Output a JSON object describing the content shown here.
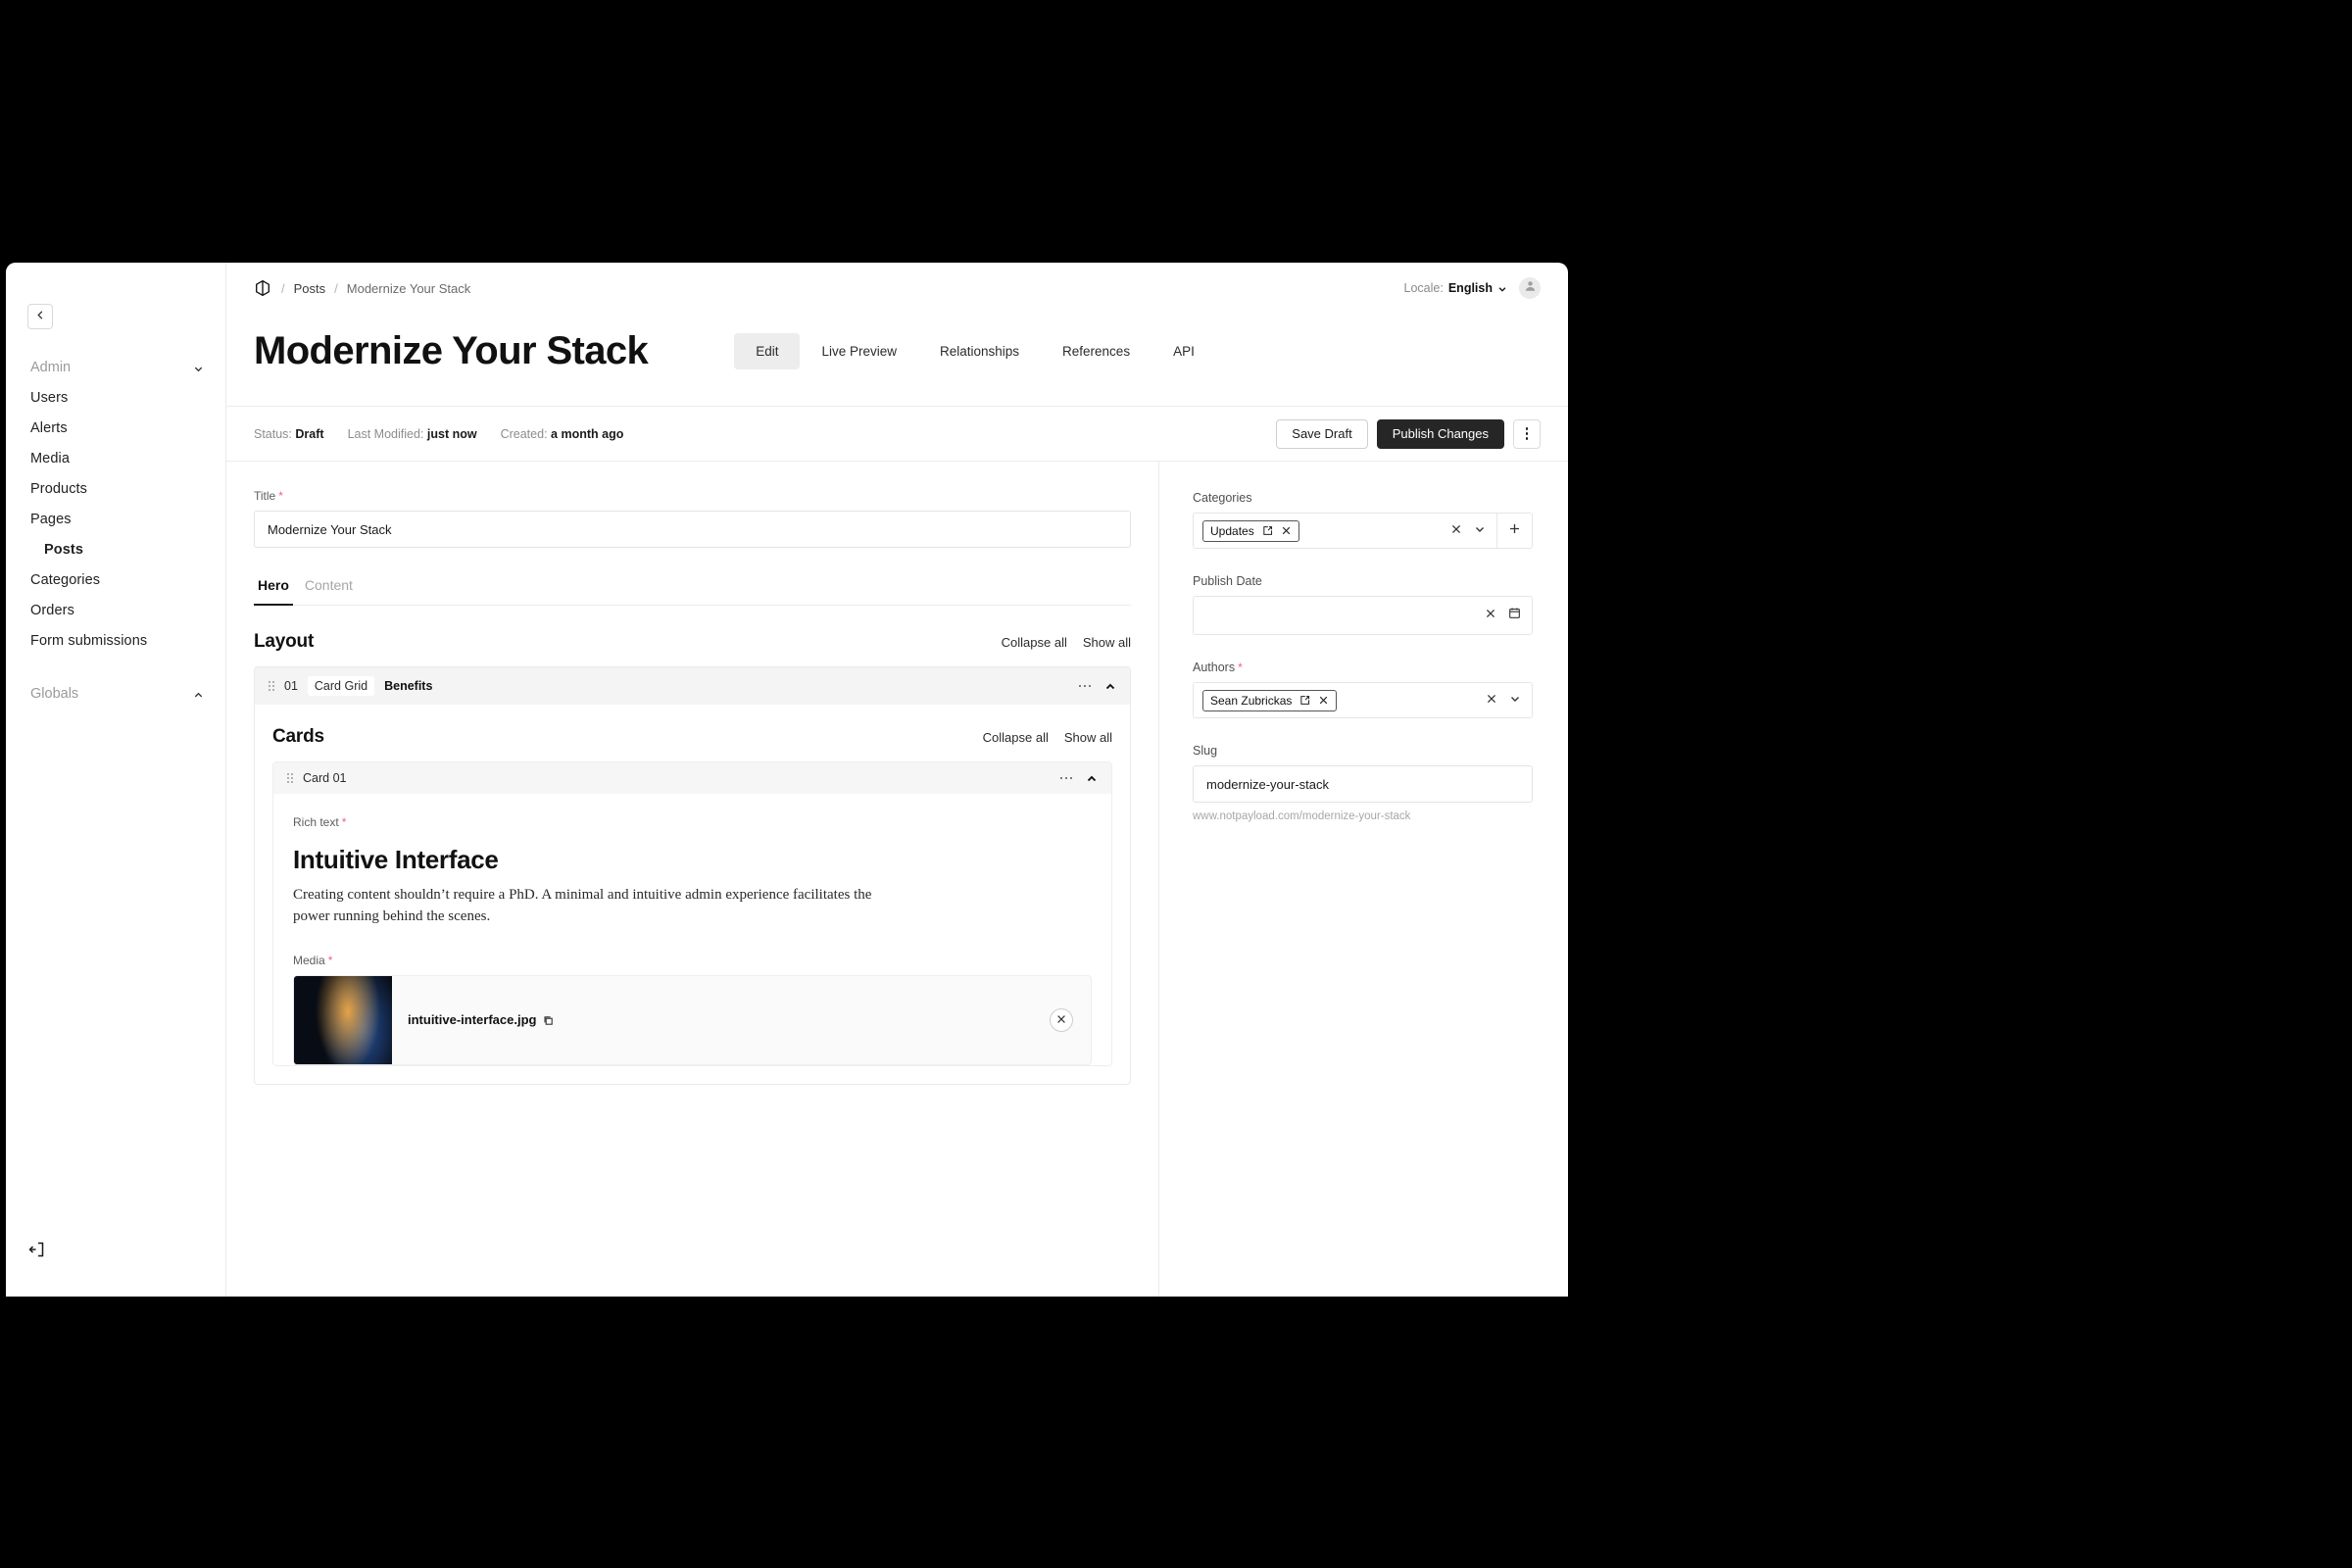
{
  "sidebar": {
    "collapse_icon": "chevron-left-icon",
    "groups": [
      {
        "label": "Admin",
        "chevron": "chevron-down-icon",
        "items": [
          {
            "label": "Users",
            "active": false
          },
          {
            "label": "Alerts",
            "active": false
          },
          {
            "label": "Media",
            "active": false
          },
          {
            "label": "Products",
            "active": false
          },
          {
            "label": "Pages",
            "active": false
          },
          {
            "label": "Posts",
            "active": true
          },
          {
            "label": "Categories",
            "active": false
          },
          {
            "label": "Orders",
            "active": false
          },
          {
            "label": "Form submissions",
            "active": false
          }
        ]
      },
      {
        "label": "Globals",
        "chevron": "chevron-up-icon",
        "items": []
      }
    ],
    "logout_icon": "logout-icon"
  },
  "topbar": {
    "logo_icon": "payload-logo-icon",
    "breadcrumb": [
      {
        "label": "Posts",
        "current": false
      },
      {
        "label": "Modernize Your Stack",
        "current": true
      }
    ],
    "separator": "/",
    "locale_label": "Locale:",
    "locale_value": "English",
    "locale_chevron": "chevron-down-icon",
    "avatar_icon": "user-avatar-icon"
  },
  "document": {
    "title": "Modernize Your Stack",
    "tabs": [
      {
        "label": "Edit",
        "active": true
      },
      {
        "label": "Live Preview",
        "active": false
      },
      {
        "label": "Relationships",
        "active": false
      },
      {
        "label": "References",
        "active": false
      },
      {
        "label": "API",
        "active": false
      }
    ]
  },
  "statusbar": {
    "items": [
      {
        "label": "Status:",
        "value": "Draft"
      },
      {
        "label": "Last Modified:",
        "value": "just now"
      },
      {
        "label": "Created:",
        "value": "a month ago"
      }
    ],
    "save_draft_label": "Save Draft",
    "publish_label": "Publish Changes",
    "more_icon": "more-vertical-icon"
  },
  "editor": {
    "title_field": {
      "label": "Title",
      "required": "*",
      "value": "Modernize Your Stack"
    },
    "subtabs": [
      {
        "label": "Hero",
        "active": true
      },
      {
        "label": "Content",
        "active": false
      }
    ],
    "layout_section": {
      "title": "Layout",
      "collapse_all": "Collapse all",
      "show_all": "Show all"
    },
    "block": {
      "drag_icon": "drag-handle-icon",
      "number": "01",
      "type": "Card Grid",
      "name": "Benefits",
      "more_icon": "more-horizontal-icon",
      "collapse_icon": "chevron-up-icon",
      "cards_section": {
        "title": "Cards",
        "collapse_all": "Collapse all",
        "show_all": "Show all"
      },
      "card": {
        "name": "Card 01",
        "drag_icon": "drag-handle-icon",
        "more_icon": "more-horizontal-icon",
        "collapse_icon": "chevron-up-icon",
        "rich_text": {
          "label": "Rich text",
          "required": "*",
          "heading": "Intuitive Interface",
          "paragraph": "Creating content shouldn’t require a PhD. A minimal and intuitive admin experience facilitates the power running behind the scenes."
        },
        "media": {
          "label": "Media",
          "required": "*",
          "filename": "intuitive-interface.jpg",
          "copy_icon": "copy-icon",
          "remove_icon": "close-circle-icon"
        }
      }
    }
  },
  "sidepanel": {
    "categories": {
      "label": "Categories",
      "chips": [
        {
          "label": "Updates",
          "edit_icon": "external-link-icon",
          "remove_icon": "close-icon"
        }
      ],
      "clear_icon": "close-icon",
      "dropdown_icon": "chevron-down-icon",
      "add_icon": "plus-icon"
    },
    "publish_date": {
      "label": "Publish Date",
      "value": "",
      "clear_icon": "close-icon",
      "calendar_icon": "calendar-icon"
    },
    "authors": {
      "label": "Authors",
      "required": "*",
      "chips": [
        {
          "label": "Sean Zubrickas",
          "edit_icon": "external-link-icon",
          "remove_icon": "close-icon"
        }
      ],
      "clear_icon": "close-icon",
      "dropdown_icon": "chevron-down-icon"
    },
    "slug": {
      "label": "Slug",
      "value": "modernize-your-stack",
      "helper": "www.notpayload.com/modernize-your-stack"
    }
  },
  "colors": {
    "accent_dark": "#262626",
    "required_red": "#f2617a",
    "muted": "#8d8d8d"
  }
}
